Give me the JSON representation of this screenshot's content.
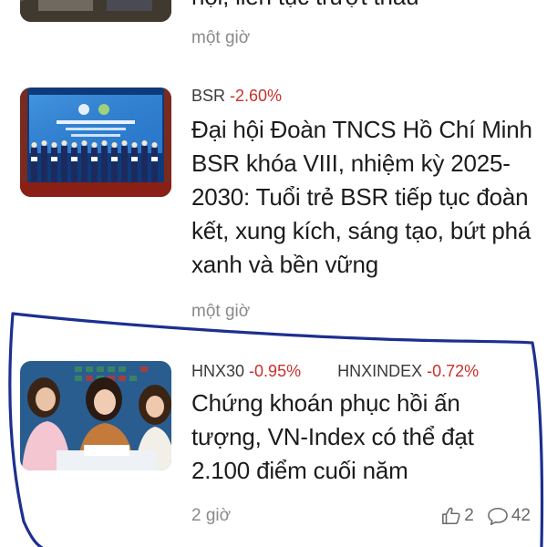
{
  "articles": [
    {
      "title": "hội, liên tục trượt thầu",
      "time": "một giờ"
    },
    {
      "ticker": {
        "symbol": "BSR",
        "change": "-2.60%"
      },
      "title": "Đại hội Đoàn TNCS Hồ Chí Minh BSR khóa VIII, nhiệm kỳ 2025-2030: Tuổi trẻ BSR tiếp tục đoàn kết, xung kích, sáng tạo, bứt phá xanh và bền vững",
      "time": "một giờ"
    },
    {
      "tickers": [
        {
          "symbol": "HNX30",
          "change": "-0.95%"
        },
        {
          "symbol": "HNXINDEX",
          "change": "-0.72%"
        }
      ],
      "title": "Chứng khoán phục hồi ấn tượng, VN-Index có thể đạt 2.100 điểm cuối năm",
      "time": "2 giờ",
      "likes": "2",
      "comments": "42"
    }
  ],
  "icons": {
    "like": "thumbs-up-icon",
    "comment": "comment-bubble-icon"
  },
  "colors": {
    "negative": "#c9302c",
    "annotation": "#1d2f8f",
    "muted": "#8a8a8a"
  }
}
